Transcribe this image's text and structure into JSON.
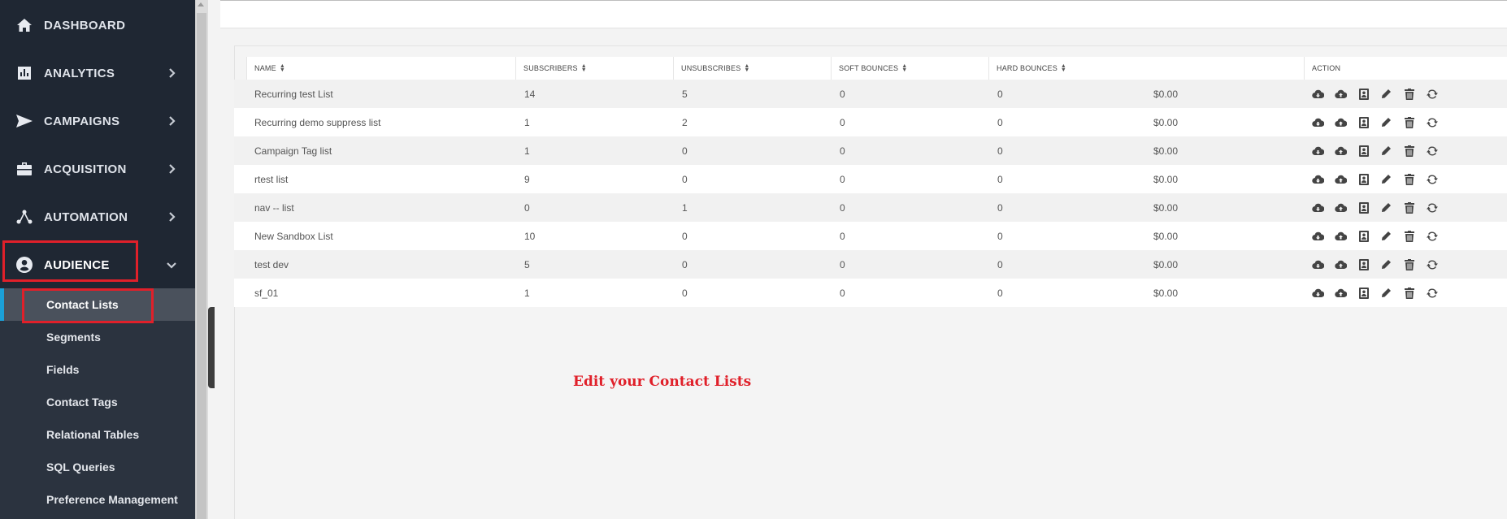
{
  "sidebar": {
    "items": [
      {
        "label": "DASHBOARD",
        "icon": "home-icon"
      },
      {
        "label": "ANALYTICS",
        "icon": "bar-chart-icon"
      },
      {
        "label": "CAMPAIGNS",
        "icon": "paper-plane-icon"
      },
      {
        "label": "ACQUISITION",
        "icon": "briefcase-icon"
      },
      {
        "label": "AUTOMATION",
        "icon": "workflow-icon"
      },
      {
        "label": "AUDIENCE",
        "icon": "user-circle-icon"
      }
    ],
    "submenu": [
      {
        "label": "Contact Lists"
      },
      {
        "label": "Segments"
      },
      {
        "label": "Fields"
      },
      {
        "label": "Contact Tags"
      },
      {
        "label": "Relational Tables"
      },
      {
        "label": "SQL Queries"
      },
      {
        "label": "Preference Management"
      }
    ]
  },
  "table": {
    "headers": [
      "NAME",
      "SUBSCRIBERS",
      "UNSUBSCRIBES",
      "SOFT BOUNCES",
      "HARD BOUNCES",
      "ACTION"
    ],
    "rows": [
      {
        "name": "Recurring test List",
        "subscribers": "14",
        "unsubscribes": "5",
        "soft": "0",
        "hard": "0",
        "amount": "$0.00"
      },
      {
        "name": "Recurring demo suppress list",
        "subscribers": "1",
        "unsubscribes": "2",
        "soft": "0",
        "hard": "0",
        "amount": "$0.00"
      },
      {
        "name": "Campaign Tag list",
        "subscribers": "1",
        "unsubscribes": "0",
        "soft": "0",
        "hard": "0",
        "amount": "$0.00"
      },
      {
        "name": "rtest list",
        "subscribers": "9",
        "unsubscribes": "0",
        "soft": "0",
        "hard": "0",
        "amount": "$0.00"
      },
      {
        "name": "nav -- list",
        "subscribers": "0",
        "unsubscribes": "1",
        "soft": "0",
        "hard": "0",
        "amount": "$0.00"
      },
      {
        "name": "New Sandbox List",
        "subscribers": "10",
        "unsubscribes": "0",
        "soft": "0",
        "hard": "0",
        "amount": "$0.00"
      },
      {
        "name": "test dev",
        "subscribers": "5",
        "unsubscribes": "0",
        "soft": "0",
        "hard": "0",
        "amount": "$0.00"
      },
      {
        "name": "sf_01",
        "subscribers": "1",
        "unsubscribes": "0",
        "soft": "0",
        "hard": "0",
        "amount": "$0.00"
      }
    ],
    "action_icons": [
      "cloud-download-icon",
      "cloud-upload-icon",
      "contact-card-icon",
      "pencil-icon",
      "trash-icon",
      "refresh-icon"
    ]
  },
  "caption": "Edit your Contact Lists",
  "colors": {
    "sidebar": "#1f2733",
    "submenu": "#2b333f",
    "highlight": "#e0202a",
    "accent": "#1ba0d8"
  }
}
